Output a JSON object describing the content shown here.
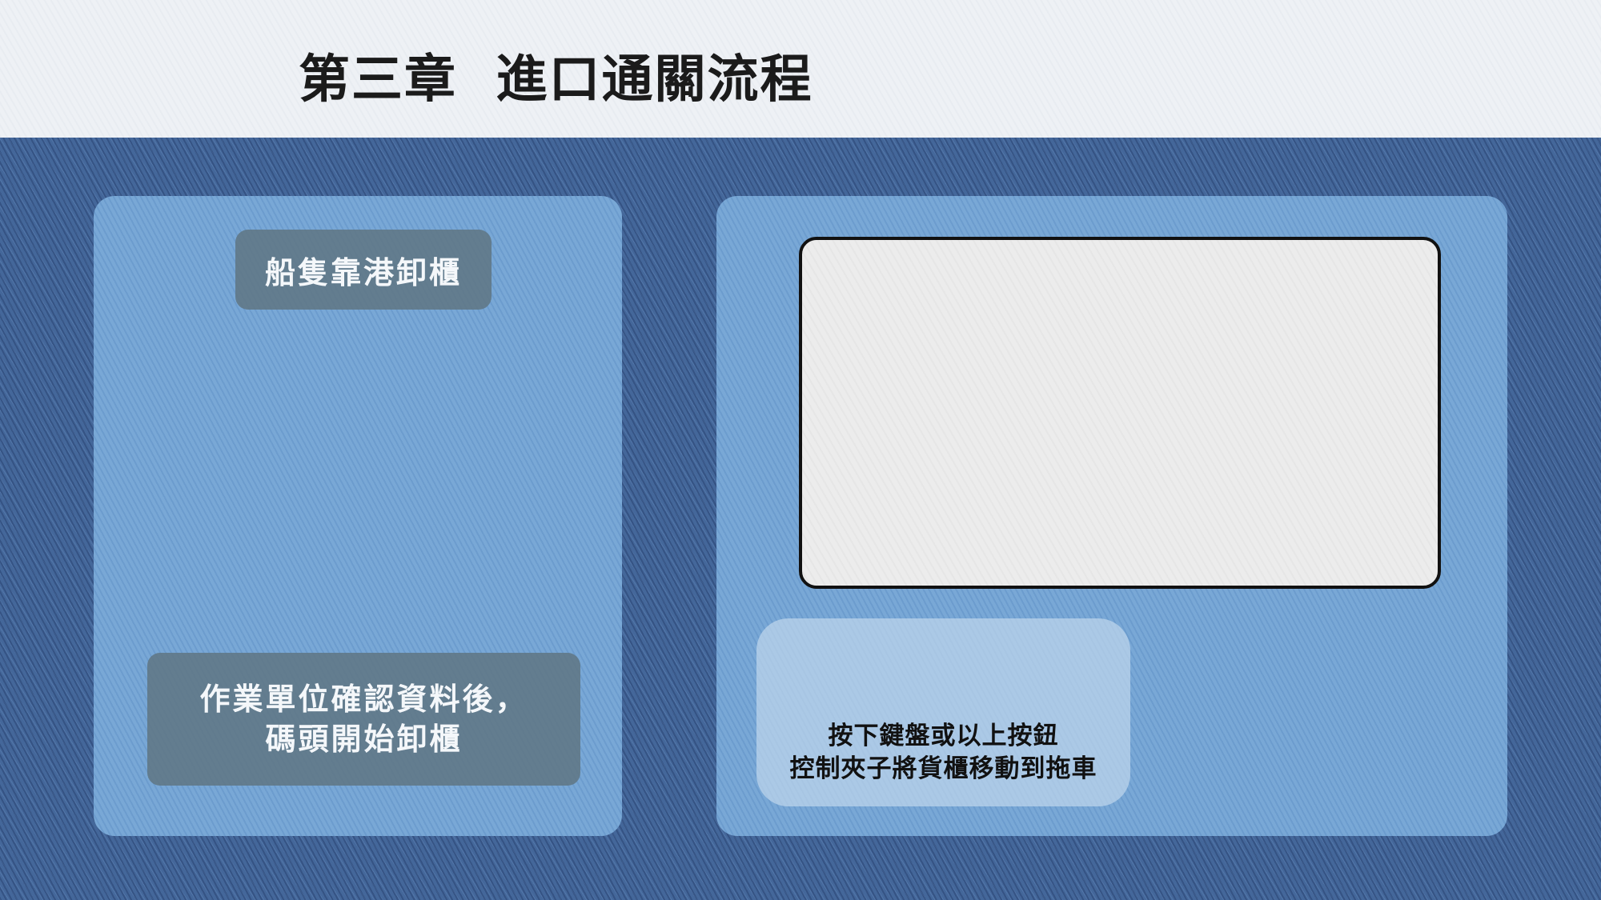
{
  "header": {
    "title": "第三章  進口通關流程"
  },
  "left_panel": {
    "step_label": "船隻靠港卸櫃",
    "description_line1": "作業單位確認資料後，",
    "description_line2": "碼頭開始卸櫃"
  },
  "right_panel": {
    "instruction_line1": "按下鍵盤或以上按鈕",
    "instruction_line2": "控制夾子將貨櫃移動到拖車"
  }
}
